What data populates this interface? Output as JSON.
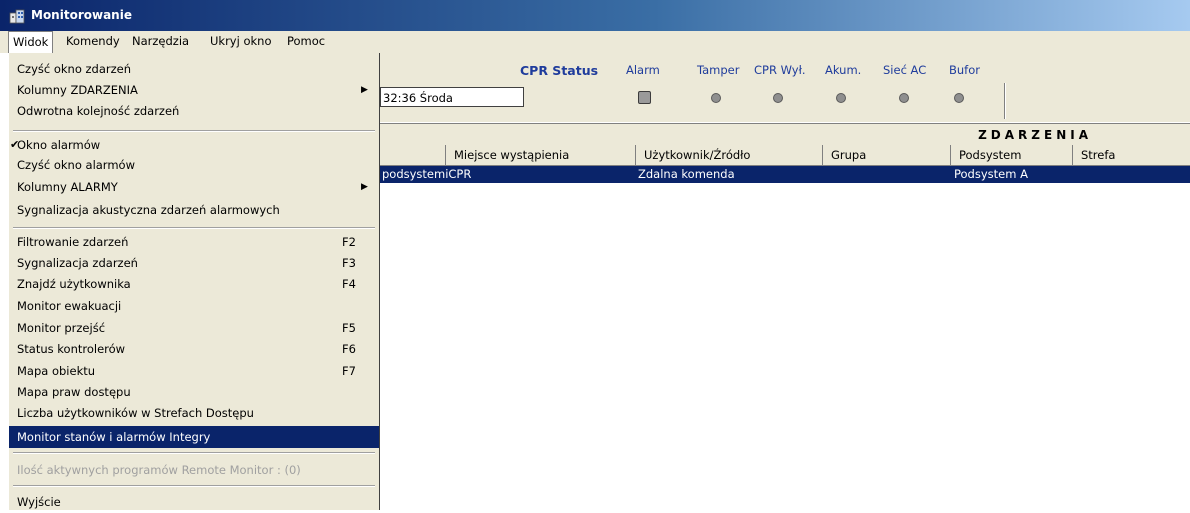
{
  "window": {
    "title": "Monitorowanie",
    "app_icon": "building-icon"
  },
  "menubar": {
    "items": [
      "Widok",
      "Komendy",
      "Narzędzia",
      "Ukryj okno",
      "Pomoc"
    ]
  },
  "status_panel": {
    "cpr_status_label": "CPR Status",
    "headers": [
      "Alarm",
      "Tamper",
      "CPR Wył.",
      "Akum.",
      "Sieć AC",
      "Bufor"
    ],
    "datetime": "32:36  Środa"
  },
  "events": {
    "section_title": "ZDARZENIA",
    "columns": [
      "Miejsce wystąpienia",
      "Użytkownik/Źródło",
      "Grupa",
      "Podsystem",
      "Strefa"
    ],
    "selected_row": {
      "place": "podsystemiCPR",
      "user": "Zdalna komenda",
      "subsystem": "Podsystem A"
    }
  },
  "dropdown": {
    "items": [
      {
        "label": "Czyść okno zdarzeń"
      },
      {
        "label": "Kolumny ZDARZENIA",
        "submenu": true
      },
      {
        "label": "Odwrotna kolejność zdarzeń"
      },
      {
        "label": "Okno alarmów",
        "checked": true
      },
      {
        "label": "Czyść okno alarmów"
      },
      {
        "label": "Kolumny ALARMY",
        "submenu": true
      },
      {
        "label": "Sygnalizacja akustyczna zdarzeń alarmowych"
      },
      {
        "label": "Filtrowanie zdarzeń",
        "shortcut": "F2"
      },
      {
        "label": "Sygnalizacja zdarzeń",
        "shortcut": "F3"
      },
      {
        "label": "Znajdź użytkownika",
        "shortcut": "F4"
      },
      {
        "label": "Monitor ewakuacji"
      },
      {
        "label": "Monitor przejść",
        "shortcut": "F5"
      },
      {
        "label": "Status kontrolerów",
        "shortcut": "F6"
      },
      {
        "label": "Mapa obiektu",
        "shortcut": "F7"
      },
      {
        "label": "Mapa praw dostępu"
      },
      {
        "label": "Liczba użytkowników w Strefach Dostępu"
      },
      {
        "label": "Monitor stanów i alarmów Integry",
        "highlighted": true
      },
      {
        "label": "Ilość aktywnych programów Remote Monitor : (0)",
        "disabled": true
      },
      {
        "label": "Wyjście"
      }
    ]
  }
}
